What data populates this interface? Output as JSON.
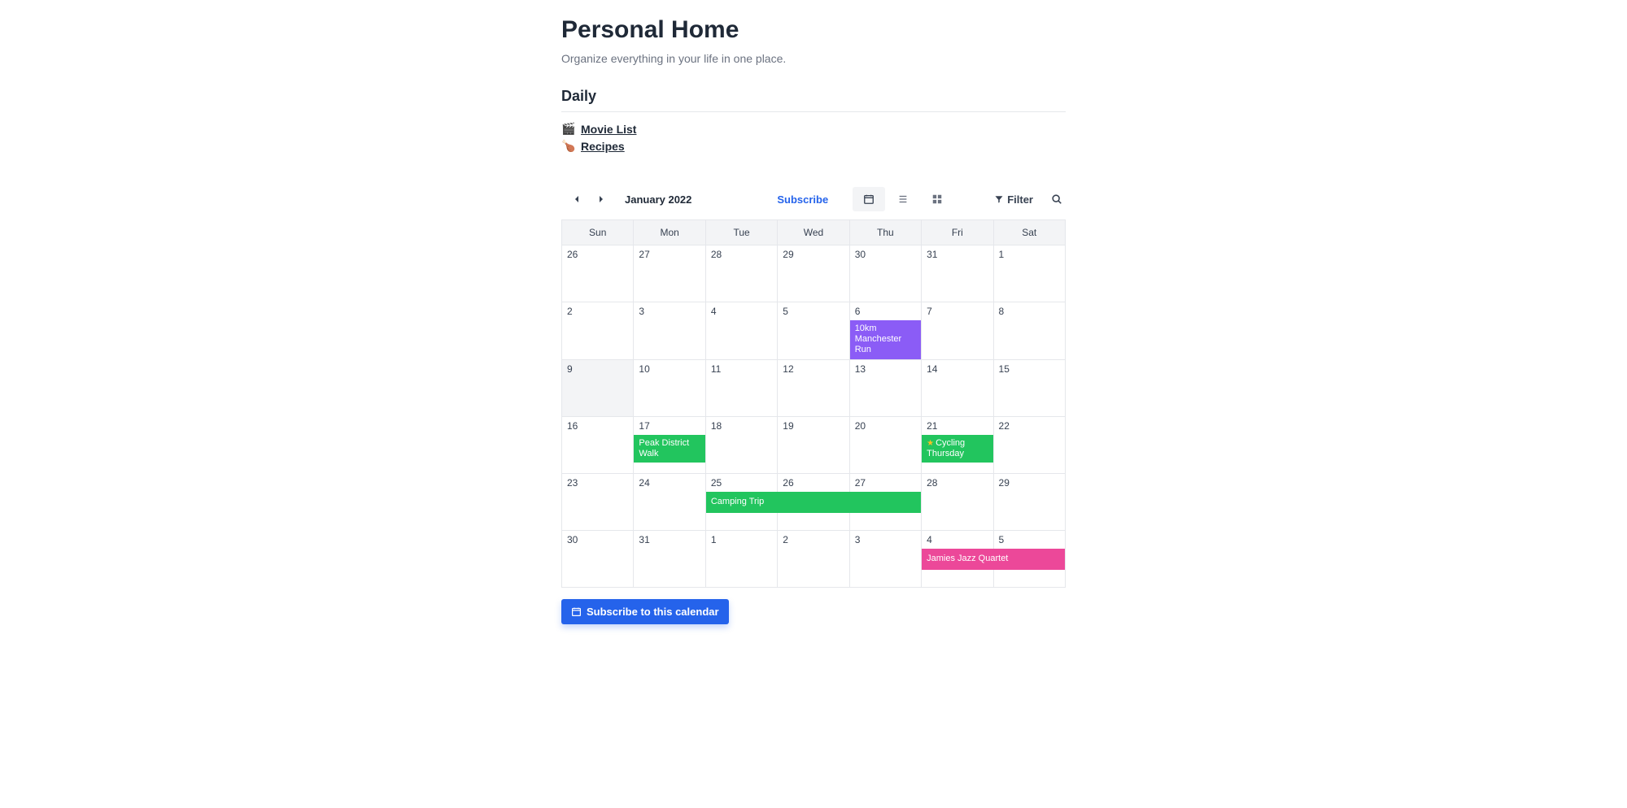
{
  "header": {
    "title": "Personal Home",
    "subtitle": "Organize everything in your life in one place."
  },
  "daily": {
    "title": "Daily",
    "links": [
      {
        "emoji": "🎬",
        "label": "Movie List"
      },
      {
        "emoji": "🍗",
        "label": "Recipes"
      }
    ]
  },
  "calendar": {
    "month_label": "January 2022",
    "subscribe_label": "Subscribe",
    "filter_label": "Filter",
    "days": [
      "Sun",
      "Mon",
      "Tue",
      "Wed",
      "Thu",
      "Fri",
      "Sat"
    ],
    "weeks": [
      [
        {
          "num": "26"
        },
        {
          "num": "27"
        },
        {
          "num": "28"
        },
        {
          "num": "29"
        },
        {
          "num": "30"
        },
        {
          "num": "31"
        },
        {
          "num": "1"
        }
      ],
      [
        {
          "num": "2"
        },
        {
          "num": "3"
        },
        {
          "num": "4"
        },
        {
          "num": "5"
        },
        {
          "num": "6",
          "event": {
            "text": "10km Manchester Run",
            "color": "purple"
          }
        },
        {
          "num": "7"
        },
        {
          "num": "8"
        }
      ],
      [
        {
          "num": "9",
          "today": true
        },
        {
          "num": "10"
        },
        {
          "num": "11"
        },
        {
          "num": "12"
        },
        {
          "num": "13"
        },
        {
          "num": "14"
        },
        {
          "num": "15"
        }
      ],
      [
        {
          "num": "16"
        },
        {
          "num": "17",
          "event": {
            "text": "Peak District Walk",
            "color": "green"
          }
        },
        {
          "num": "18"
        },
        {
          "num": "19"
        },
        {
          "num": "20"
        },
        {
          "num": "21",
          "event": {
            "text": "Cycling Thursday",
            "color": "green",
            "star": true
          }
        },
        {
          "num": "22"
        }
      ],
      [
        {
          "num": "23"
        },
        {
          "num": "24"
        },
        {
          "num": "25",
          "span_event": {
            "text": "Camping Trip",
            "color": "green",
            "span": 3
          }
        },
        {
          "num": "26"
        },
        {
          "num": "27"
        },
        {
          "num": "28"
        },
        {
          "num": "29"
        }
      ],
      [
        {
          "num": "30"
        },
        {
          "num": "31"
        },
        {
          "num": "1"
        },
        {
          "num": "2"
        },
        {
          "num": "3"
        },
        {
          "num": "4",
          "span_event": {
            "text": "Jamies Jazz Quartet",
            "color": "pink",
            "span": 2
          }
        },
        {
          "num": "5"
        }
      ]
    ]
  },
  "subscribe_button": {
    "label": "Subscribe to this calendar"
  }
}
